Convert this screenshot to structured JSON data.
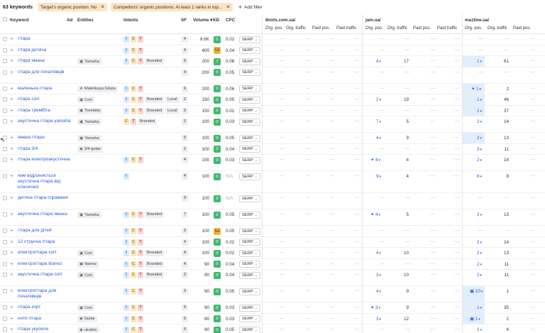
{
  "header": {
    "keyword_count": "63 keywords",
    "filters": [
      {
        "label": "Target's organic position: No"
      },
      {
        "label": "Competitors' organic positions: At least 1 ranks in top..."
      }
    ],
    "add_filter_label": "Add filter"
  },
  "columns": {
    "keyword": "Keyword",
    "ad": "Ad",
    "entities": "Entities",
    "intents": "Intents",
    "sf": "SF",
    "volume": "Volume",
    "kd": "KD",
    "cpc": "CPC"
  },
  "domains": [
    {
      "name": "8nots.com.ua/",
      "cols": [
        "Org. pos.",
        "Org. traffic",
        "Paid pos.",
        "Paid traffic"
      ]
    },
    {
      "name": "jam.ua/",
      "cols": [
        "Org. pos.",
        "Org. traffic",
        "Paid pos.",
        "Paid traffic"
      ]
    },
    {
      "name": "muzline.ua/",
      "cols": [
        "Org. pos.",
        "Org. traffic",
        "Paid pos."
      ]
    }
  ],
  "serp_label": "SERP",
  "rows": [
    {
      "kw": "гітара",
      "ent": "",
      "ent_icon": "",
      "intents": [
        "I",
        "C",
        "T"
      ],
      "tags": [],
      "sf": "4",
      "vol": "8.6K",
      "kd": "0",
      "kdc": "g",
      "cpc": "0.02",
      "d1": "—",
      "d1t": "—",
      "d2": "—",
      "d2t": "—",
      "d3": "—",
      "d3t": "—",
      "d3hl": false,
      "d2hl": false
    },
    {
      "kw": "гітара дитяча",
      "ent": "",
      "ent_icon": "",
      "intents": [
        "I",
        "C",
        "T"
      ],
      "tags": [],
      "sf": "4",
      "vol": "400",
      "kd": "53",
      "kdc": "y",
      "cpc": "0.04",
      "d1": "—",
      "d1t": "—",
      "d2": "—",
      "d2t": "—",
      "d3": "—",
      "d3t": "—",
      "d3hl": false
    },
    {
      "kw": "гітара ямаха",
      "ent": "Yamaha",
      "ent_icon": "org",
      "intents": [
        "I",
        "C",
        "T"
      ],
      "tags": [
        "Branded"
      ],
      "sf": "5",
      "vol": "200",
      "kd": "7",
      "kdc": "g",
      "cpc": "0.06",
      "d1": "—",
      "d1t": "—",
      "d2": "4",
      "d2t": "17",
      "d3": "1",
      "d3t": "61",
      "d3hl": true
    },
    {
      "kw": "гітара для початківців",
      "ent": "",
      "ent_icon": "",
      "intents": [],
      "tags": [],
      "sf": "4",
      "vol": "200",
      "kd": "0",
      "kdc": "g",
      "cpc": "0.05",
      "d1": "—",
      "d1t": "—",
      "d2": "—",
      "d2t": "—",
      "d3": "—",
      "d3t": "—",
      "d3hl": false,
      "tall": true
    },
    {
      "kw": "маленька гітара",
      "ent": "Malenkaya Gitara",
      "ent_icon": "star",
      "intents": [
        "I",
        "C",
        "T"
      ],
      "tags": [],
      "sf": "6",
      "vol": "200",
      "kd": "0",
      "kdc": "g",
      "cpc": "0.06",
      "d1": "—",
      "d1t": "—",
      "d2": "—",
      "d2t": "—",
      "d3": "1",
      "d3t": "2",
      "d3hl": true,
      "d3spark": true
    },
    {
      "kw": "гітара cort",
      "ent": "Cort",
      "ent_icon": "org",
      "intents": [
        "I",
        "C",
        "T"
      ],
      "tags": [
        "Branded",
        "Local"
      ],
      "sf": "2",
      "vol": "150",
      "kd": "0",
      "kdc": "g",
      "cpc": "0.05",
      "d1": "—",
      "d1t": "—",
      "d2": "2",
      "d2t": "19",
      "d3": "1",
      "d3t": "46",
      "d3hl": true
    },
    {
      "kw": "гітара трембіта",
      "ent": "Trembita",
      "ent_icon": "org",
      "intents": [
        "I",
        "C",
        "T"
      ],
      "tags": [
        "Branded",
        "Local"
      ],
      "sf": "3",
      "vol": "150",
      "kd": "0",
      "kdc": "g",
      "cpc": "0.01",
      "d1": "—",
      "d1t": "—",
      "d2": "—",
      "d2t": "—",
      "d3": "1",
      "d3t": "37",
      "d3hl": true
    },
    {
      "kw": "акустична гітара yamaha",
      "ent": "Yamaha",
      "ent_icon": "org",
      "intents": [
        "C",
        "T"
      ],
      "tags": [
        "Branded"
      ],
      "sf": "2",
      "vol": "100",
      "kd": "0",
      "kdc": "g",
      "cpc": "0.03",
      "d1": "—",
      "d1t": "—",
      "d2": "7",
      "d2t": "5",
      "d3": "2",
      "d3t": "14",
      "d3hl": false,
      "tall": true
    },
    {
      "kw": "ямаха гітара",
      "ent": "Yamaha",
      "ent_icon": "org",
      "intents": [],
      "tags": [],
      "sf": "5",
      "vol": "100",
      "kd": "0",
      "kdc": "g",
      "cpc": "0.05",
      "d1": "—",
      "d1t": "—",
      "d2": "4",
      "d2t": "9",
      "d3": "2",
      "d3t": "13",
      "d3hl": true
    },
    {
      "kw": "гітара 3/4",
      "ent": "3/4 guitar",
      "ent_icon": "globe",
      "intents": [],
      "tags": [],
      "sf": "2",
      "vol": "100",
      "kd": "0",
      "kdc": "g",
      "cpc": "0.04",
      "d1": "—",
      "d1t": "—",
      "d2": "—",
      "d2t": "—",
      "d3": "3",
      "d3t": "11",
      "d3hl": false
    },
    {
      "kw": "гітара електроакустична",
      "ent": "",
      "ent_icon": "",
      "intents": [
        "I",
        "C",
        "T"
      ],
      "tags": [],
      "sf": "4",
      "vol": "100",
      "kd": "0",
      "kdc": "g",
      "cpc": "0.03",
      "d1": "—",
      "d1t": "—",
      "d2": "4",
      "d2t": "4",
      "d3": "2",
      "d3t": "14",
      "d3hl": false,
      "tall": true,
      "d2spark": true
    },
    {
      "kw": "чим відрізняється акустична гітара від класичної",
      "ent": "",
      "ent_icon": "",
      "intents": [
        "I"
      ],
      "tags": [],
      "sf": "4",
      "vol": "100",
      "kd": "0",
      "kdc": "g",
      "cpc": "N/A",
      "d1": "—",
      "d1t": "—",
      "d2": "9",
      "d2t": "4",
      "d3": "6",
      "d3t": "8",
      "d3hl": false,
      "xtall": true
    },
    {
      "kw": "дитяча гітара справжня",
      "ent": "",
      "ent_icon": "",
      "intents": [],
      "tags": [],
      "sf": "3",
      "vol": "100",
      "kd": "0",
      "kdc": "g",
      "cpc": "N/A",
      "d1": "—",
      "d1t": "—",
      "d2": "—",
      "d2t": "—",
      "d3": "—",
      "d3t": "—",
      "d3hl": false,
      "tall": true
    },
    {
      "kw": "акустична гітара ямаха",
      "ent": "Yamaha",
      "ent_icon": "org",
      "intents": [
        "I",
        "C",
        "T"
      ],
      "tags": [
        "Branded"
      ],
      "sf": "7",
      "vol": "100",
      "kd": "0",
      "kdc": "g",
      "cpc": "0.05",
      "d1": "—",
      "d1t": "—",
      "d2": "4",
      "d2t": "5",
      "d3": "2",
      "d3t": "13",
      "d3hl": false,
      "tall": true,
      "d2spark": true
    },
    {
      "kw": "гітара для дітей",
      "ent": "",
      "ent_icon": "",
      "intents": [
        "I",
        "C",
        "T"
      ],
      "tags": [],
      "sf": "3",
      "vol": "100",
      "kd": "54",
      "kdc": "y",
      "cpc": "0.05",
      "d1": "—",
      "d1t": "—",
      "d2": "—",
      "d2t": "—",
      "d3": "—",
      "d3t": "—",
      "d3hl": false
    },
    {
      "kw": "12 струнна гітара",
      "ent": "",
      "ent_icon": "",
      "intents": [
        "I",
        "C",
        "T"
      ],
      "tags": [],
      "sf": "4",
      "vol": "100",
      "kd": "0",
      "kdc": "g",
      "cpc": "0.02",
      "d1": "—",
      "d1t": "—",
      "d2": "—",
      "d2t": "—",
      "d3": "2",
      "d3t": "14",
      "d3hl": false
    },
    {
      "kw": "електрогітара cort",
      "ent": "Cort",
      "ent_icon": "org",
      "intents": [
        "I",
        "C",
        "T"
      ],
      "tags": [
        "Branded"
      ],
      "sf": "4",
      "vol": "100",
      "kd": "0",
      "kdc": "g",
      "cpc": "0.02",
      "d1": "—",
      "d1t": "—",
      "d2": "4",
      "d2t": "10",
      "d3": "2",
      "d3t": "13",
      "d3hl": false
    },
    {
      "kw": "електрогітара ibanez",
      "ent": "Ibanez",
      "ent_icon": "org",
      "intents": [
        "I",
        "C",
        "T"
      ],
      "tags": [
        "Branded"
      ],
      "sf": "4",
      "vol": "90",
      "kd": "0",
      "kdc": "g",
      "cpc": "0.04",
      "d1": "—",
      "d1t": "—",
      "d2": "—",
      "d2t": "—",
      "d3": "2",
      "d3t": "11",
      "d3hl": false
    },
    {
      "kw": "акустична гітара cort",
      "ent": "Cort",
      "ent_icon": "org",
      "intents": [
        "I",
        "C",
        "T"
      ],
      "tags": [
        "Branded"
      ],
      "sf": "2",
      "vol": "90",
      "kd": "0",
      "kdc": "g",
      "cpc": "0.04",
      "d1": "—",
      "d1t": "—",
      "d2": "3",
      "d2t": "10",
      "d3": "2",
      "d3t": "11",
      "d3hl": false,
      "tall": true
    },
    {
      "kw": "електрогітара для початківців",
      "ent": "",
      "ent_icon": "",
      "intents": [
        "I",
        "C",
        "T"
      ],
      "tags": [],
      "sf": "3",
      "vol": "90",
      "kd": "0",
      "kdc": "g",
      "cpc": "0.05",
      "d1": "—",
      "d1t": "—",
      "d2": "4",
      "d2t": "9",
      "d3": "10",
      "d3t": "1",
      "d3hl": true,
      "tall": true,
      "d3img": true
    },
    {
      "kw": "гітара корт",
      "ent": "Cort",
      "ent_icon": "org",
      "intents": [
        "I",
        "C",
        "T"
      ],
      "tags": [],
      "sf": "6",
      "vol": "90",
      "kd": "0",
      "kdc": "g",
      "cpc": "0.03",
      "d1": "—",
      "d1t": "—",
      "d2": "3",
      "d2t": "9",
      "d3": "1",
      "d3t": "35",
      "d3hl": true,
      "d2spark": true
    },
    {
      "kw": "ноти гітара",
      "ent": "Guitar",
      "ent_icon": "globe",
      "intents": [
        "I",
        "C",
        "T"
      ],
      "tags": [],
      "sf": "5",
      "vol": "90",
      "kd": "0",
      "kdc": "g",
      "cpc": "0.03",
      "d1": "—",
      "d1t": "—",
      "d2": "3",
      "d2t": "12",
      "d3": "1",
      "d3t": "2",
      "d3hl": true,
      "d3img": true
    },
    {
      "kw": "гітара укулеле",
      "ent": "ukulele",
      "ent_icon": "globe",
      "intents": [
        "I",
        "C",
        "T"
      ],
      "tags": [],
      "sf": "5",
      "vol": "90",
      "kd": "0",
      "kdc": "g",
      "cpc": "0.05",
      "d1": "—",
      "d1t": "—",
      "d2": "—",
      "d2t": "—",
      "d3": "1",
      "d3t": "4",
      "d3hl": false
    }
  ]
}
